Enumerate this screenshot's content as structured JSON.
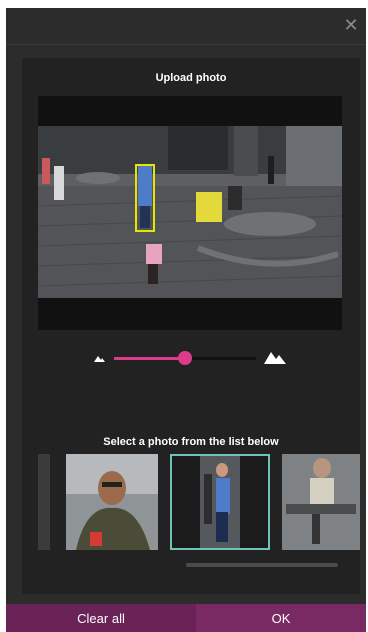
{
  "window": {
    "close_glyph": "✕"
  },
  "dialog": {
    "title": "Upload photo",
    "list_title": "Select a photo from the list below"
  },
  "zoom": {
    "level": 0.5,
    "min_icon": "small-mountain-icon",
    "max_icon": "large-mountain-icon",
    "accent": "#dd3b8a"
  },
  "thumbnails": [
    {
      "name": "partial-thumbnail",
      "selected": false
    },
    {
      "name": "man-with-cup",
      "selected": false
    },
    {
      "name": "woman-standing",
      "selected": true
    },
    {
      "name": "man-at-table",
      "selected": false
    }
  ],
  "footer": {
    "clear_label": "Clear all",
    "ok_label": "OK"
  },
  "colors": {
    "face_box": "#e6e600",
    "selection": "#6fc3b6",
    "button_bg": "#6a2356"
  }
}
